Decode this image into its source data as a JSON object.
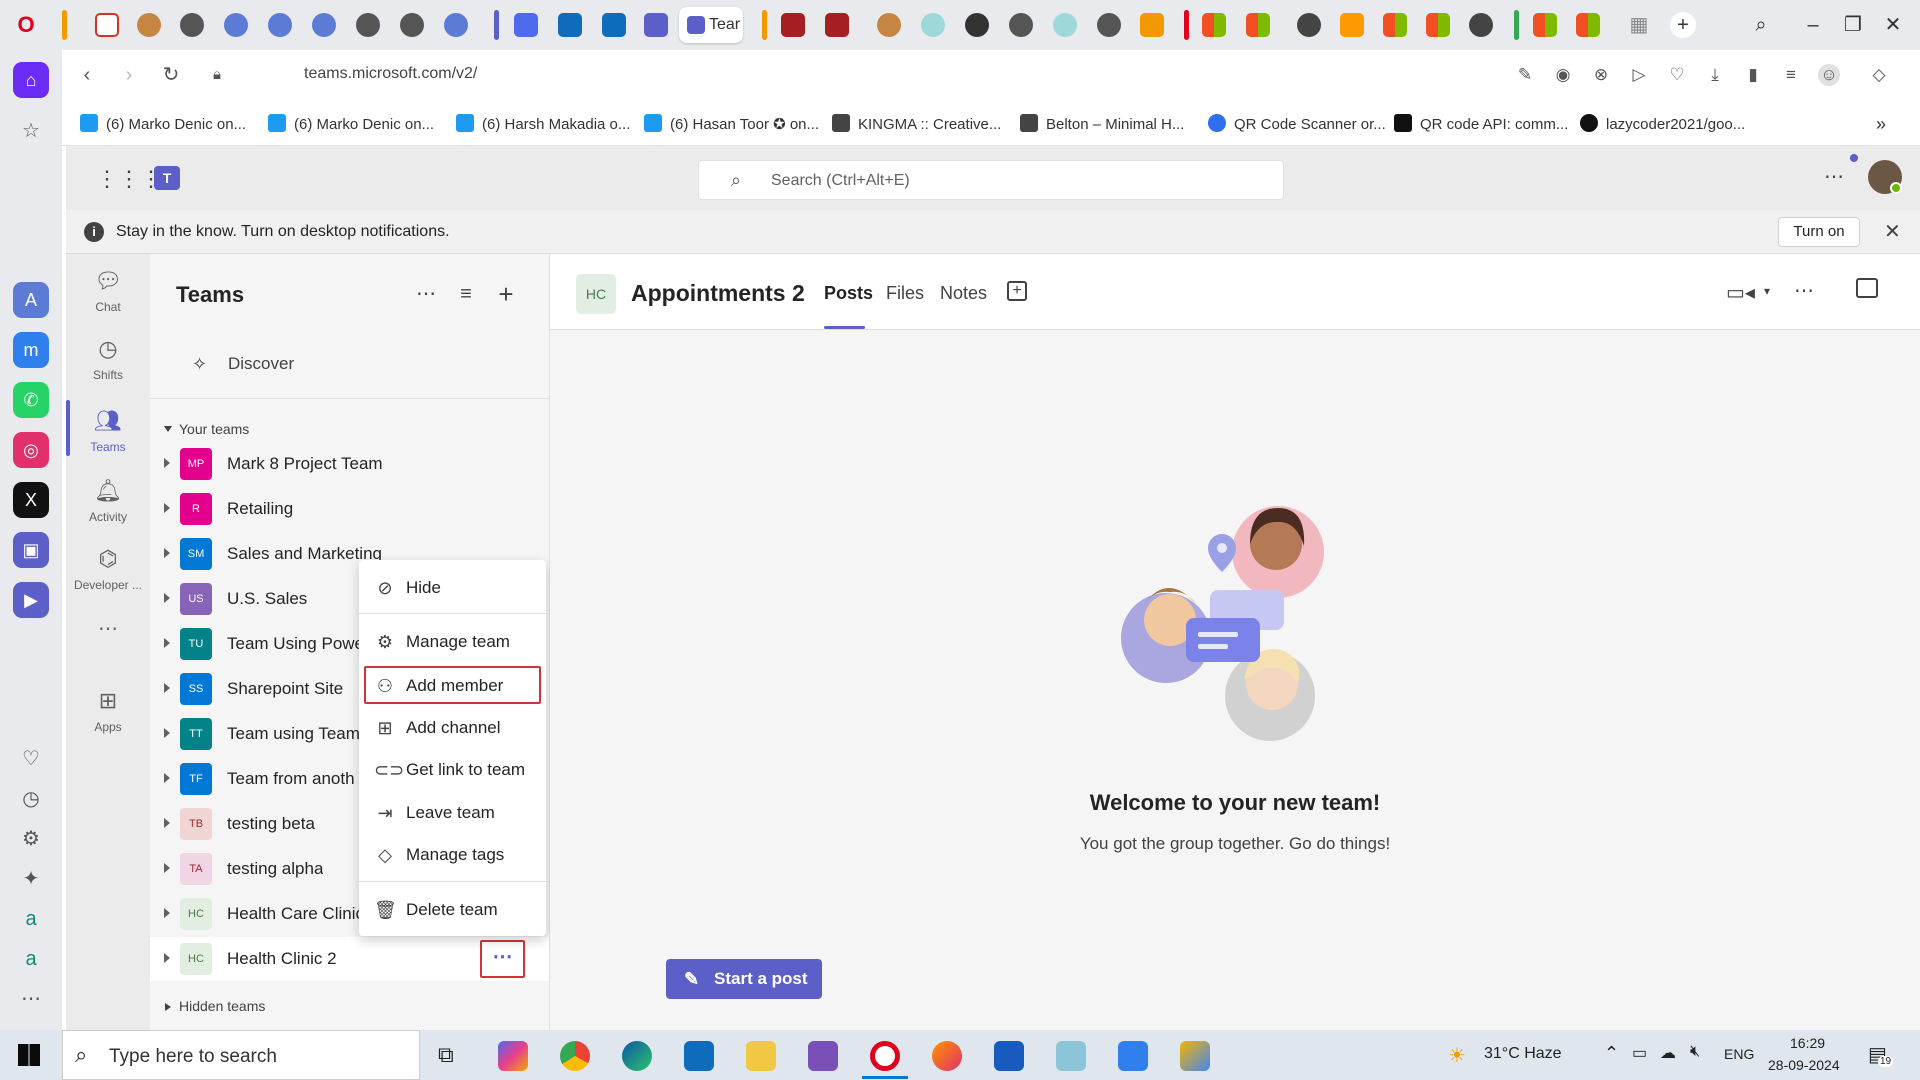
{
  "browser": {
    "active_tab_label": "Tear",
    "url": "teams.microsoft.com/v2/",
    "bookmarks": [
      "(6) Marko Denic on...",
      "(6) Marko Denic on...",
      "(6) Harsh Makadia o...",
      "(6) Hasan Toor ✪ on...",
      "KINGMA :: Creative...",
      "Belton – Minimal H...",
      "QR Code Scanner or...",
      "QR code API: comm...",
      "lazycoder2021/goo..."
    ]
  },
  "teams": {
    "search_placeholder": "Search (Ctrl+Alt+E)",
    "notification": {
      "message": "Stay in the know. Turn on desktop notifications.",
      "turn_on_label": "Turn on"
    },
    "rail": [
      {
        "label": "Chat",
        "icon": "chat-icon"
      },
      {
        "label": "Shifts",
        "icon": "shifts-icon"
      },
      {
        "label": "Teams",
        "icon": "teams-icon"
      },
      {
        "label": "Activity",
        "icon": "bell-icon"
      },
      {
        "label": "Developer ...",
        "icon": "developer-icon"
      },
      {
        "label": "Apps",
        "icon": "add-apps-icon"
      }
    ],
    "panel": {
      "title": "Teams",
      "discover_label": "Discover",
      "your_teams_label": "Your teams",
      "hidden_teams_label": "Hidden teams",
      "teams": [
        {
          "initials": "MP",
          "name": "Mark 8 Project Team",
          "color": "#e3008c"
        },
        {
          "initials": "R",
          "name": "Retailing",
          "color": "#e3008c"
        },
        {
          "initials": "SM",
          "name": "Sales and Marketing",
          "color": "#0078d4"
        },
        {
          "initials": "US",
          "name": "U.S. Sales",
          "color": "#8764b8"
        },
        {
          "initials": "TU",
          "name": "Team Using Power",
          "color": "#038387"
        },
        {
          "initials": "SS",
          "name": "Sharepoint Site",
          "color": "#0078d4"
        },
        {
          "initials": "TT",
          "name": "Team using Teams",
          "color": "#038387"
        },
        {
          "initials": "TF",
          "name": "Team from anoth",
          "color": "#0078d4"
        },
        {
          "initials": "TB",
          "name": "testing beta",
          "color": "#f1d5d5"
        },
        {
          "initials": "TA",
          "name": "testing alpha",
          "color": "#f1d5e5"
        },
        {
          "initials": "HC",
          "name": "Health Care Clinic",
          "color": "#e2eee2"
        },
        {
          "initials": "HC",
          "name": "Health Clinic 2",
          "color": "#e2eee2"
        }
      ]
    },
    "context_menu": [
      {
        "label": "Hide",
        "icon": "eye-off-icon"
      },
      {
        "label": "Manage team",
        "icon": "gear-icon"
      },
      {
        "label": "Add member",
        "icon": "add-person-icon"
      },
      {
        "label": "Add channel",
        "icon": "add-channel-icon"
      },
      {
        "label": "Get link to team",
        "icon": "link-icon"
      },
      {
        "label": "Leave team",
        "icon": "leave-icon"
      },
      {
        "label": "Manage tags",
        "icon": "tag-icon"
      },
      {
        "label": "Delete team",
        "icon": "trash-icon"
      }
    ],
    "channel": {
      "avatar": "HC",
      "name": "Appointments 2",
      "tabs": [
        "Posts",
        "Files",
        "Notes"
      ],
      "welcome_title": "Welcome to your new team!",
      "welcome_subtitle": "You got the group together. Go do things!",
      "start_post_label": "Start a post"
    }
  },
  "taskbar": {
    "search_placeholder": "Type here to search",
    "weather": "31°C  Haze",
    "language": "ENG",
    "time": "16:29",
    "date": "28-09-2024",
    "notification_count": "19"
  }
}
